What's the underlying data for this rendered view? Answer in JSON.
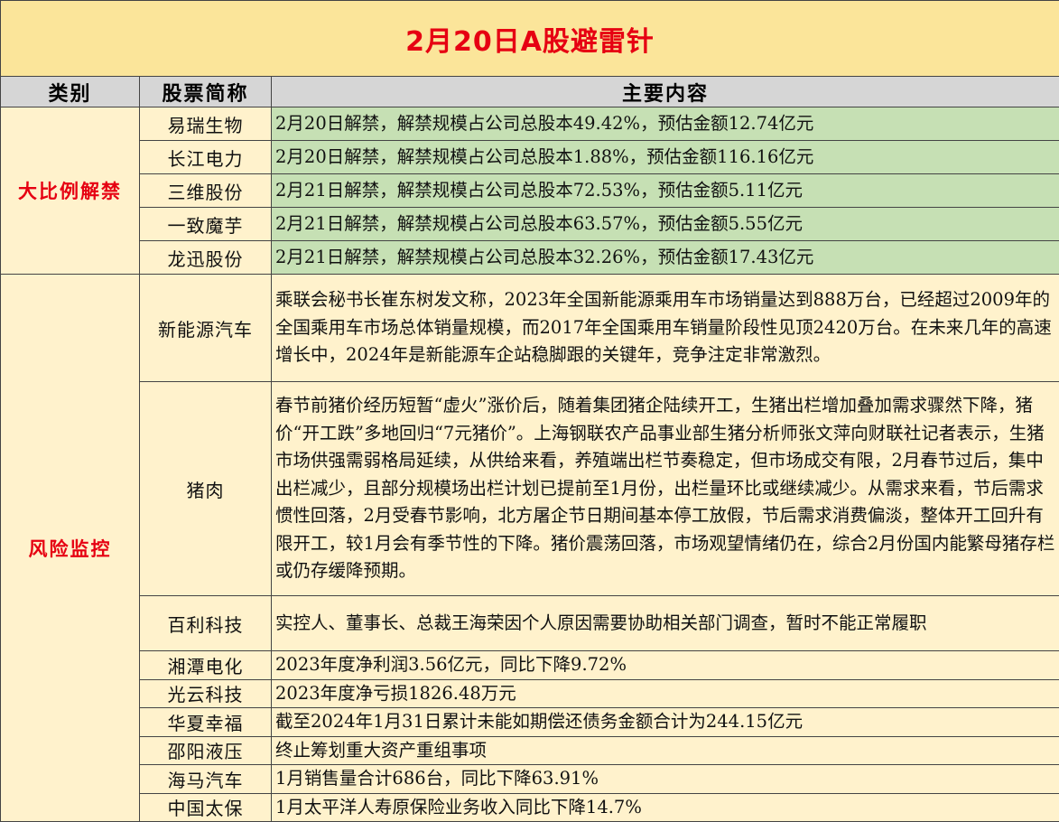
{
  "title": "2月20日A股避雷针",
  "headers": {
    "category": "类别",
    "stock": "股票简称",
    "content": "主要内容"
  },
  "unlock": {
    "category": "大比例解禁",
    "rows": [
      {
        "stock": "易瑞生物",
        "content": "2月20日解禁，解禁规模占公司总股本49.42%，预估金额12.74亿元"
      },
      {
        "stock": "长江电力",
        "content": "2月20日解禁，解禁规模占公司总股本1.88%，预估金额116.16亿元"
      },
      {
        "stock": "三维股份",
        "content": "2月21日解禁，解禁规模占公司总股本72.53%，预估金额5.11亿元"
      },
      {
        "stock": "一致魔芋",
        "content": "2月21日解禁，解禁规模占公司总股本63.57%，预估金额5.55亿元"
      },
      {
        "stock": "龙迅股份",
        "content": "2月21日解禁，解禁规模占公司总股本32.26%，预估金额17.43亿元"
      }
    ]
  },
  "risk": {
    "category": "风险监控",
    "rows": [
      {
        "stock": "新能源汽车",
        "content": "乘联会秘书长崔东树发文称，2023年全国新能源乘用车市场销量达到888万台，已经超过2009年的全国乘用车市场总体销量规模，而2017年全国乘用车销量阶段性见顶2420万台。在未来几年的高速增长中，2024年是新能源车企站稳脚跟的关键年，竞争注定非常激烈。"
      },
      {
        "stock": "猪肉",
        "content": "春节前猪价经历短暂“虚火”涨价后，随着集团猪企陆续开工，生猪出栏增加叠加需求骤然下降，猪价“开工跌”多地回归“7元猪价”。上海钢联农产品事业部生猪分析师张文萍向财联社记者表示，生猪市场供强需弱格局延续，从供给来看，养殖端出栏节奏稳定，但市场成交有限，2月春节过后，集中出栏减少，且部分规模场出栏计划已提前至1月份，出栏量环比或继续减少。从需求来看，节后需求惯性回落，2月受春节影响，北方屠企节日期间基本停工放假，节后需求消费偏淡，整体开工回升有限开工，较1月会有季节性的下降。猪价震荡回落，市场观望情绪仍在，综合2月份国内能繁母猪存栏或仍存缓降预期。"
      },
      {
        "stock": "百利科技",
        "content": "实控人、董事长、总裁王海荣因个人原因需要协助相关部门调查，暂时不能正常履职"
      },
      {
        "stock": "湘潭电化",
        "content": "2023年度净利润3.56亿元，同比下降9.72%"
      },
      {
        "stock": "光云科技",
        "content": "2023年度净亏损1826.48万元"
      },
      {
        "stock": "华夏幸福",
        "content": "截至2024年1月31日累计未能如期偿还债务金额合计为244.15亿元"
      },
      {
        "stock": "邵阳液压",
        "content": "终止筹划重大资产重组事项"
      },
      {
        "stock": "海马汽车",
        "content": "1月销售量合计686台，同比下降63.91%"
      },
      {
        "stock": "中国太保",
        "content": "1月太平洋人寿原保险业务收入同比下降14.7%"
      }
    ]
  }
}
